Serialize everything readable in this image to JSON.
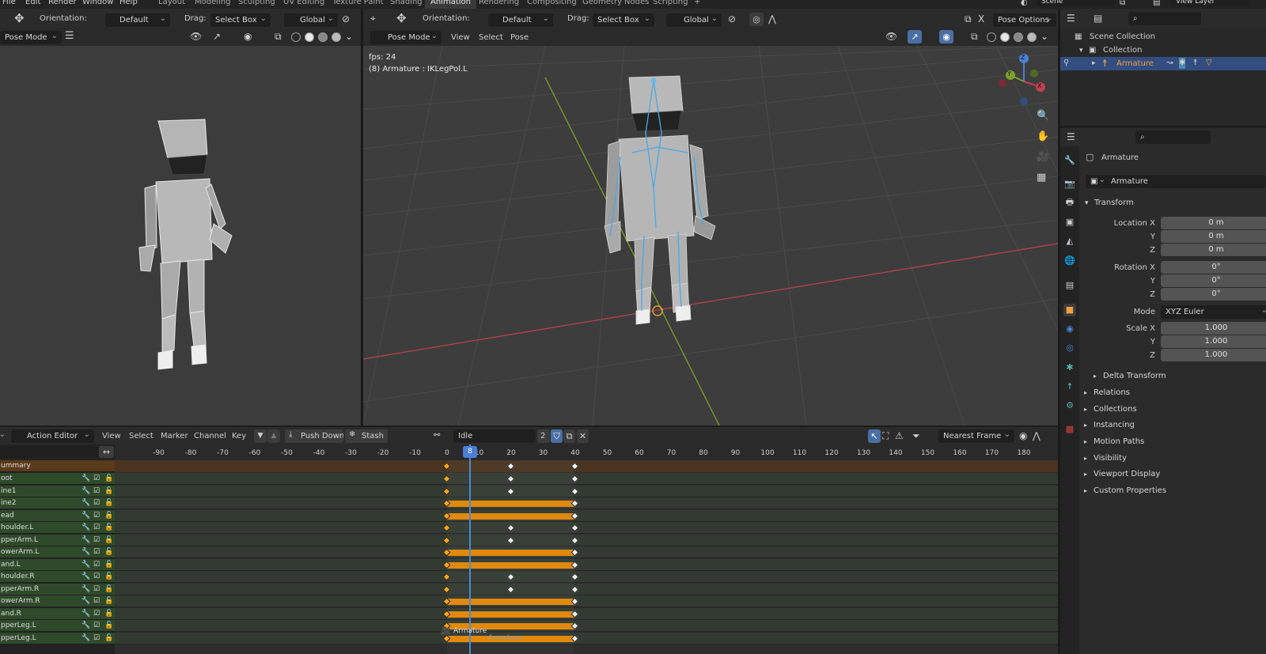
{
  "topbar": {
    "menus": [
      "File",
      "Edit",
      "Render",
      "Window",
      "Help"
    ],
    "workspaces": [
      "Layout",
      "Modeling",
      "Sculpting",
      "UV Editing",
      "Texture Paint",
      "Shading",
      "Animation",
      "Rendering",
      "Compositing",
      "Geometry Nodes",
      "Scripting"
    ],
    "add_tab": "+",
    "active_workspace": "Animation",
    "scene": "Scene",
    "view_layer": "View Layer"
  },
  "left_view": {
    "orientation_label": "Orientation:",
    "orientation_value": "Default",
    "drag_label": "Drag:",
    "drag_value": "Select Box",
    "transform_orientation": "Global",
    "mode": "Pose Mode"
  },
  "main_view": {
    "orientation_label": "Orientation:",
    "orientation_value": "Default",
    "drag_label": "Drag:",
    "drag_value": "Select Box",
    "transform_orientation": "Global",
    "pose_options": "Pose Options",
    "mode": "Pose Mode",
    "menus": [
      "View",
      "Select",
      "Pose"
    ],
    "fps_text": "fps: 24",
    "object_text": "(8) Armature : IKLegPol.L",
    "gizmo": {
      "x": "X",
      "y": "Y",
      "z": "Z"
    }
  },
  "outliner": {
    "scene_collection": "Scene Collection",
    "collection": "Collection",
    "armature": "Armature"
  },
  "properties": {
    "object_name": "Armature",
    "data_name": "Armature",
    "transform_title": "Transform",
    "location_x_label": "Location X",
    "rotation_x_label": "Rotation X",
    "scale_x_label": "Scale X",
    "y_label": "Y",
    "z_label": "Z",
    "mode_label": "Mode",
    "location": [
      "0 m",
      "0 m",
      "0 m"
    ],
    "rotation": [
      "0°",
      "0°",
      "0°"
    ],
    "rotation_mode": "XYZ Euler",
    "scale": [
      "1.000",
      "1.000",
      "1.000"
    ],
    "delta_transform": "Delta Transform",
    "panels": [
      "Relations",
      "Collections",
      "Instancing",
      "Motion Paths",
      "Visibility",
      "Viewport Display",
      "Custom Properties"
    ]
  },
  "action_editor": {
    "editor_type": "Action Editor",
    "menus": [
      "View",
      "Select",
      "Marker",
      "Channel",
      "Key"
    ],
    "push_down": "Push Down",
    "stash": "Stash",
    "action_name": "Idle",
    "users": "2",
    "snapping": "Nearest Frame",
    "current_frame": "8",
    "ruler": [
      "-90",
      "-80",
      "-70",
      "-60",
      "-50",
      "-40",
      "-30",
      "-20",
      "-10",
      "0",
      "10",
      "20",
      "30",
      "40",
      "50",
      "60",
      "70",
      "80",
      "90",
      "100",
      "110",
      "120",
      "130",
      "140",
      "150",
      "160",
      "170",
      "180"
    ],
    "summary_label": "ummary",
    "channels": [
      {
        "name": "oot",
        "type": "keys"
      },
      {
        "name": "ine1",
        "type": "keys"
      },
      {
        "name": "ine2",
        "type": "hold"
      },
      {
        "name": "ead",
        "type": "hold"
      },
      {
        "name": "houlder.L",
        "type": "keys"
      },
      {
        "name": "pperArm.L",
        "type": "keys"
      },
      {
        "name": "owerArm.L",
        "type": "hold"
      },
      {
        "name": "and.L",
        "type": "hold"
      },
      {
        "name": "houlder.R",
        "type": "keys"
      },
      {
        "name": "pperArm.R",
        "type": "keys"
      },
      {
        "name": "owerArm.R",
        "type": "hold"
      },
      {
        "name": "and.R",
        "type": "hold"
      },
      {
        "name": "pperLeg.L",
        "type": "hold"
      },
      {
        "name": "pperLeg.L",
        "type": "hold"
      }
    ],
    "key_frames": [
      0,
      20,
      40
    ],
    "footer_object": "Armature",
    "footer_action": "Armature"
  }
}
